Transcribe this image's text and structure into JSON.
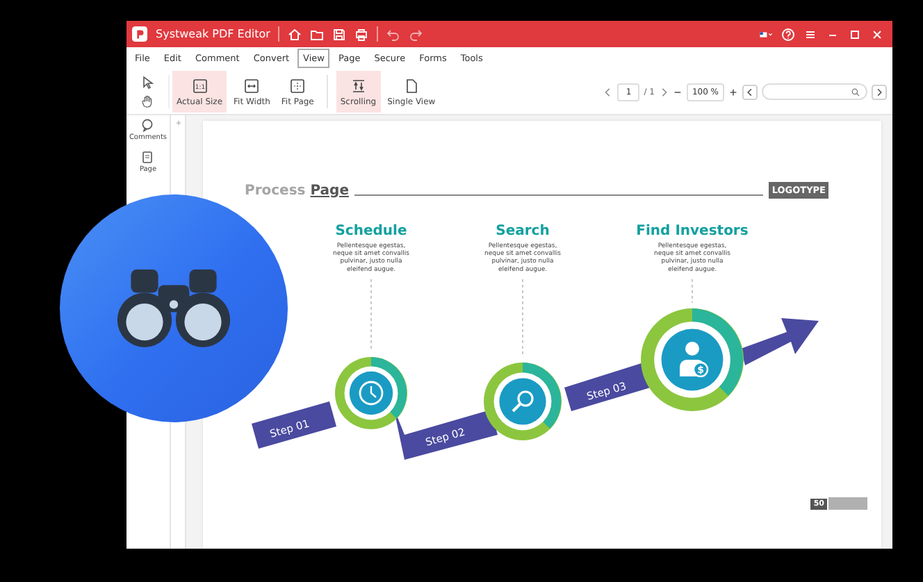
{
  "window": {
    "title": "Systweak PDF Editor"
  },
  "menu": [
    {
      "label": "File",
      "selected": false
    },
    {
      "label": "Edit",
      "selected": false
    },
    {
      "label": "Comment",
      "selected": false
    },
    {
      "label": "Convert",
      "selected": false
    },
    {
      "label": "View",
      "selected": true
    },
    {
      "label": "Page",
      "selected": false
    },
    {
      "label": "Secure",
      "selected": false
    },
    {
      "label": "Forms",
      "selected": false
    },
    {
      "label": "Tools",
      "selected": false
    }
  ],
  "tools": [
    {
      "kind": "actual",
      "label": "Actual Size",
      "icon_text": "1:1",
      "selected": true
    },
    {
      "kind": "width",
      "label": "Fit Width",
      "selected": false
    },
    {
      "kind": "page",
      "label": "Fit Page",
      "selected": false
    },
    {
      "kind": "scroll",
      "label": "Scrolling",
      "selected": true
    },
    {
      "kind": "single",
      "label": "Single View",
      "selected": false
    }
  ],
  "navigation": {
    "page": "1",
    "total": "/ 1",
    "zoom": "100 %"
  },
  "sidebar": [
    {
      "kind": "comments",
      "label": "Comments"
    },
    {
      "kind": "page",
      "label": "Page"
    }
  ],
  "document": {
    "heading": "Process **Page**",
    "logo": "LOGOTYPE",
    "steps": [
      {
        "title": "Schedule",
        "body": [
          "Pellentesque egestas,",
          "neque sit amet convallis",
          "pulvinar, justo nulla",
          "eleifend augue."
        ],
        "step": "Step 01",
        "kind": "clock"
      },
      {
        "title": "Search",
        "body": [
          "Pellentesque egestas,",
          "neque sit amet convallis",
          "pulvinar, justo nulla",
          "eleifend augue."
        ],
        "step": "Step 02",
        "kind": "search"
      },
      {
        "title": "Find Investors",
        "body": [
          "Pellentesque egestas,",
          "neque sit amet convallis",
          "pulvinar, justo nulla",
          "eleifend augue."
        ],
        "step": "Step 03",
        "kind": "investor",
        "icon_text": "$"
      }
    ],
    "page_number": "50"
  }
}
